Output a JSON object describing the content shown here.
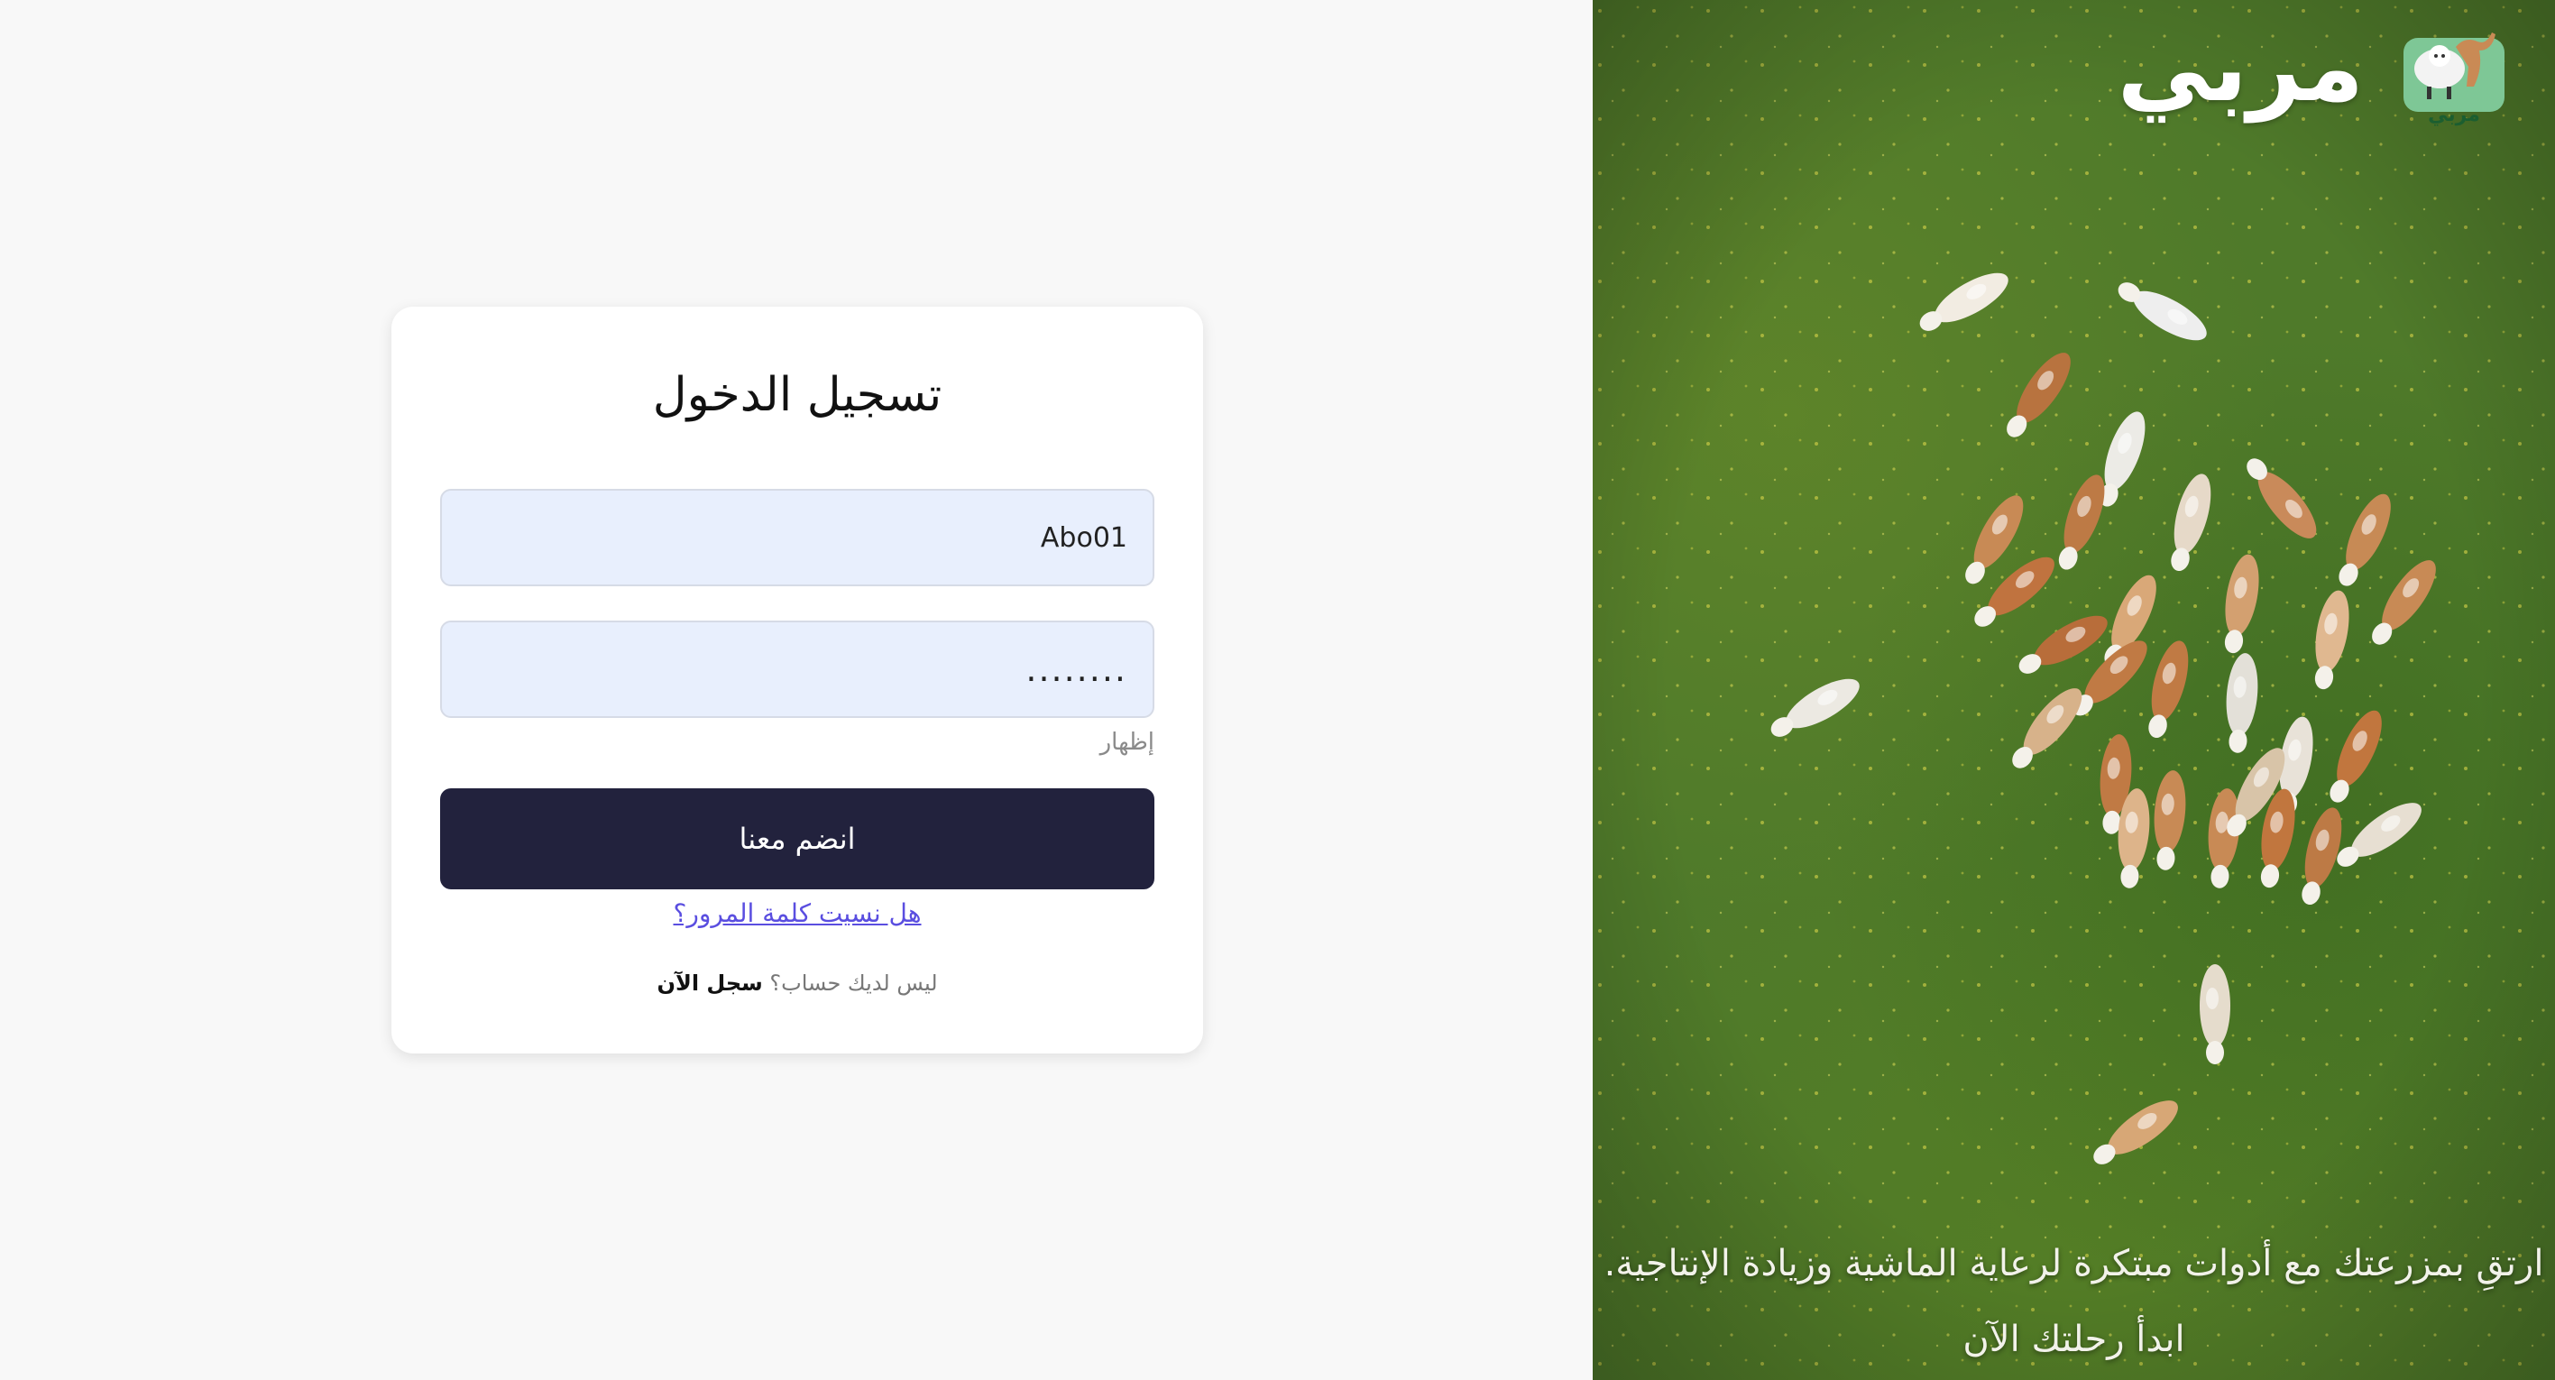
{
  "login": {
    "title": "تسجيل الدخول",
    "username_value": "Abo01",
    "password_value": "........",
    "show_password_label": "إظهار",
    "submit_label": "انضم معنا",
    "forgot_password_link": "هل نسيت كلمة المرور؟",
    "no_account_text": "ليس لديك حساب؟",
    "signup_link": "سجل الآن"
  },
  "hero": {
    "brand_name": "مربي",
    "logo_caption": "مربي",
    "tagline_line1": "ارتقِ بمزرعتك مع أدوات مبتكرة لرعاية الماشية وزيادة الإنتاجية.",
    "tagline_line2": "ابدأ رحلتك الآن",
    "image_subject": "aerial-cattle-herd-on-grass"
  },
  "colors": {
    "page_background": "#f8f8f8",
    "card_background": "#ffffff",
    "input_background": "#e8effd",
    "button_background": "#22223d",
    "link_color": "#5a4ee0",
    "grass_green": "#4f7a2a"
  }
}
